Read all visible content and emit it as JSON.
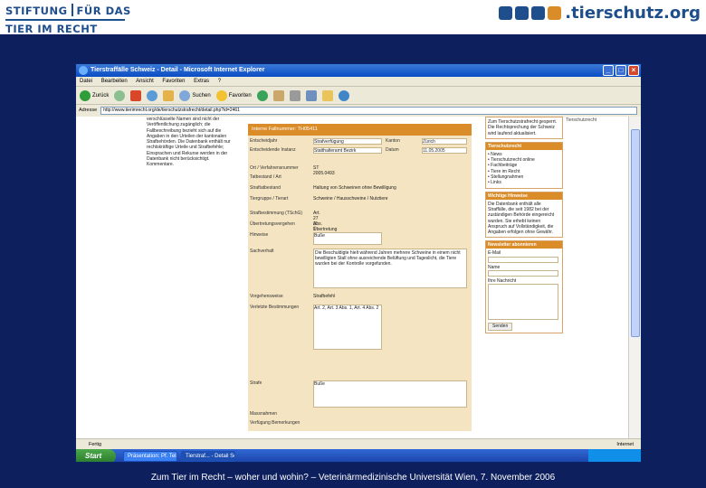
{
  "slide": {
    "logo_left_line1a": "STIFTUNG",
    "logo_left_line1b": "FÜR DAS",
    "logo_left_line2": "TIER IM RECHT",
    "logo_right_text": ".tierschutz.org",
    "logo_squares": [
      "#1f4e8c",
      "#1f4e8c",
      "#1f4e8c",
      "#d98c28"
    ],
    "footer": "Zum Tier im Recht – woher und wohin? – Veterinärmedizinische Universität Wien, 7. November 2006"
  },
  "browser": {
    "title": "Tierstraffälle Schweiz - Detail - Microsoft Internet Explorer",
    "menu": [
      "Datei",
      "Bearbeiten",
      "Ansicht",
      "Favoriten",
      "Extras",
      "?"
    ],
    "toolbar": {
      "back": "Zurück",
      "search": "Suchen",
      "favorites": "Favoriten"
    },
    "address_label": "Adresse",
    "address": "http://www.tierimrecht.org/de/tierschutzstrafrecht/detail.php?id=2461",
    "status": "Fertig",
    "status_zone": "Internet"
  },
  "taskbar": {
    "start": "Start",
    "tasks": [
      "Präsentation: Pf. Tel 1",
      "Tierstraf... - Detail Schweiz"
    ]
  },
  "page": {
    "left_text": "verschlüsselte Namen sind nicht der Veröffentlichung zugänglich; die Fallbeschreibung bezieht sich auf die Angaben in den Urteilen der kantonalen Strafbehörden. Die Datenbank enthält nur rechtskräftige Urteile und Strafbefehle; Einsprachen und Rekurse werden in der Datenbank nicht berücksichtigt. Kommentare.",
    "form_head": "Interne Fallnummer: TH05411",
    "form_rows": [
      {
        "label": "Entscheidjahr",
        "value": "Strafverfügung"
      },
      {
        "label": "Entscheidende Instanz",
        "value": "Statthalteramt Bezirk"
      },
      {
        "label": "Ort / Verfahrensnummer",
        "value": "ST 2005.0493"
      },
      {
        "label": "Tatbestand / Art",
        "value": ""
      },
      {
        "label": "Straftatbestand",
        "value": "Haltung von Schweinen ohne Bewilligung"
      },
      {
        "label": "Tiergruppe / Tierart",
        "value": "Schweine / Hausschweine / Nutztiere"
      },
      {
        "label": "Strafbestimmung (TSchG)",
        "value": "Art. 27 Abs. 1"
      },
      {
        "label": "Übertretungsvergehen",
        "value": "Übertretung"
      },
      {
        "label": "Hinweise",
        "value": "Buße"
      },
      {
        "label": "Sachverhalt",
        "value": "Die Beschuldigte hielt während Jahren mehrere Schweine in einem nicht bewilligten Stall ohne ausreichende Belüftung und Tageslicht, die Tiere wurden bei der Kontrolle vorgefunden."
      },
      {
        "label": "Verfahrensart",
        "value": "Strafbefehl"
      },
      {
        "label": "Verletzte Bestimmungen",
        "value": "Art. 2, Art. 3 Abs. 1, Art. 4 Abs. 2"
      },
      {
        "label": "Strafe",
        "value": "Buße"
      },
      {
        "label": "Massnahmen",
        "value": ""
      },
      {
        "label": "Verfügung Bemerkungen",
        "value": ""
      }
    ],
    "form_right_labels": [
      "Kanton",
      "Datum"
    ],
    "form_right_values": [
      "Zürich",
      "11.05.2005"
    ],
    "section_header": "Vorgehensweise",
    "right": {
      "top_text": "Zum Tierschutzstrafrecht gesperrt. Die Rechtsprechung der Schweiz wird laufend aktualisiert.",
      "nav_title": "Tierschutzrecht",
      "nav_items": [
        "News",
        "Tierschutzrecht online",
        "Fachbeiträge",
        "Tiere im Recht",
        "Stellungnahmen",
        "Links"
      ],
      "box2_title": "Wichtige Hinweise",
      "box2_text": "Die Datenbank enthält alle Straffälle, die seit 1982 bei der zuständigen Behörde eingereicht wurden. Sie erhebt keinen Anspruch auf Vollständigkeit, die Angaben erfolgen ohne Gewähr.",
      "box3_title": "Newsletter abonnieren",
      "box3_labels": [
        "E-Mail",
        "Name",
        "Ihre Nachricht"
      ],
      "box3_button": "Senden"
    }
  }
}
